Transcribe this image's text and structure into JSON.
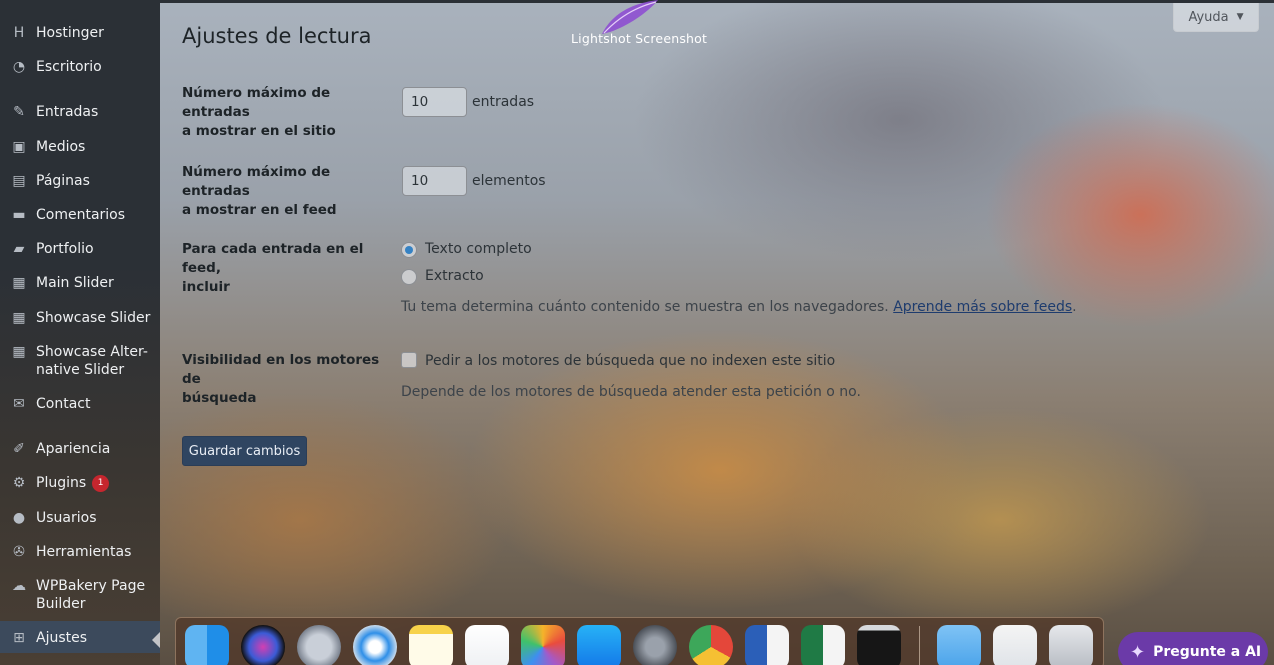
{
  "sidebar": {
    "items": [
      {
        "label": "Hostinger",
        "icon": "hostinger-icon",
        "glyph": "H"
      },
      {
        "label": "Escritorio",
        "icon": "dashboard-icon",
        "glyph": "◔"
      },
      {
        "label": "Entradas",
        "icon": "pin-icon",
        "glyph": "✎"
      },
      {
        "label": "Medios",
        "icon": "media-icon",
        "glyph": "▣"
      },
      {
        "label": "Páginas",
        "icon": "pages-icon",
        "glyph": "▤"
      },
      {
        "label": "Comentarios",
        "icon": "comments-icon",
        "glyph": "▬"
      },
      {
        "label": "Portfolio",
        "icon": "folder-icon",
        "glyph": "▰"
      },
      {
        "label": "Main Slider",
        "icon": "slider-icon",
        "glyph": "▦"
      },
      {
        "label": "Showcase Slider",
        "icon": "slider-icon",
        "glyph": "▦"
      },
      {
        "label": "Showcase Alter-",
        "label2": "native Slider",
        "icon": "slider-icon",
        "glyph": "▦"
      },
      {
        "label": "Contact",
        "icon": "mail-icon",
        "glyph": "✉"
      },
      {
        "label": "Apariencia",
        "icon": "brush-icon",
        "glyph": "✐"
      },
      {
        "label": "Plugins",
        "icon": "plugin-icon",
        "glyph": "⚙",
        "badge": "1"
      },
      {
        "label": "Usuarios",
        "icon": "user-icon",
        "glyph": "●"
      },
      {
        "label": "Herramientas",
        "icon": "wrench-icon",
        "glyph": "✇"
      },
      {
        "label": "WPBakery Page",
        "label2": "Builder",
        "icon": "wpbakery-icon",
        "glyph": "☁"
      },
      {
        "label": "Ajustes",
        "icon": "settings-icon",
        "glyph": "⊞",
        "active": true
      }
    ]
  },
  "header": {
    "help": "Ayuda",
    "help_caret": "▼"
  },
  "overlay": {
    "lightshot": "Lightshot Screenshot"
  },
  "page": {
    "title": "Ajustes de lectura"
  },
  "form": {
    "posts_label": "Número máximo de entradas",
    "posts_label2": "a mostrar en el sitio",
    "posts_value": "10",
    "posts_unit": "entradas",
    "feed_label": "Número máximo de entradas",
    "feed_label2": "a mostrar en el feed",
    "feed_value": "10",
    "feed_unit": "elementos",
    "include_label": "Para cada entrada en el feed,",
    "include_label2": "incluir",
    "opt_full": "Texto completo",
    "opt_excerpt": "Extracto",
    "theme_desc": "Tu tema determina cuánto contenido se muestra en los navegadores.",
    "learn_link": "Aprende más sobre feeds",
    "learn_period": ".",
    "visibility_label": "Visibilidad en los motores de",
    "visibility_label2": "búsqueda",
    "visibility_option": "Pedir a los motores de búsqueda que no indexen este sitio",
    "visibility_desc": "Depende de los motores de búsqueda atender esta petición o no.",
    "save": "Guardar cambios"
  },
  "dock": {
    "apps": [
      "finder-icon",
      "siri-icon",
      "launchpad-icon",
      "safari-icon",
      "notes-icon",
      "reminders-icon",
      "photos-icon",
      "app-store-icon",
      "system-preferences-icon",
      "chrome-icon",
      "word-icon",
      "excel-icon",
      "terminal-icon",
      "folder-icon",
      "preview-icon",
      "trash-icon"
    ]
  },
  "ai_button": {
    "label": "Pregunte a AI"
  }
}
